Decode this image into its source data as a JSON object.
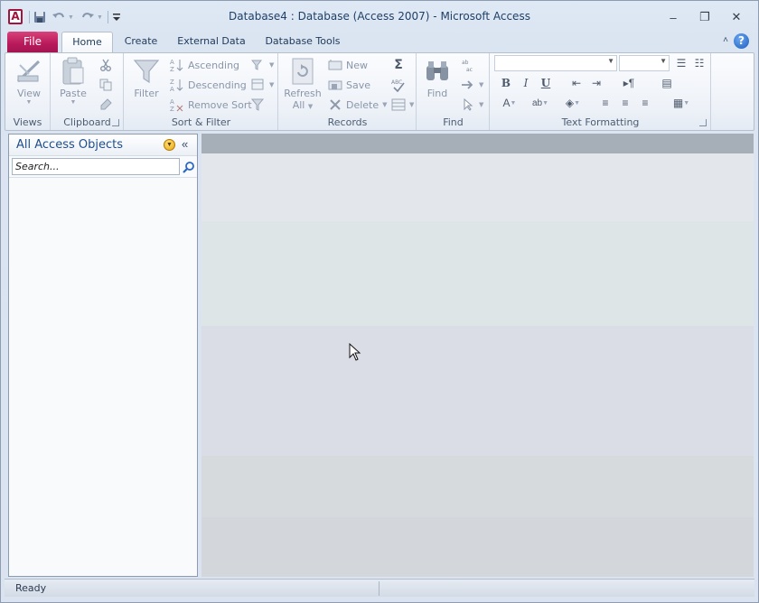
{
  "window": {
    "title": "Database4 : Database (Access 2007)  -  Microsoft Access",
    "app_icon_letter": "A",
    "controls": {
      "minimize": "–",
      "restore": "❐",
      "close": "✕"
    }
  },
  "quick_access": {
    "save": "save-icon",
    "undo": "undo-icon",
    "redo": "redo-icon",
    "customize": "customize-icon"
  },
  "tabs": {
    "file": "File",
    "home": "Home",
    "create": "Create",
    "external_data": "External Data",
    "database_tools": "Database Tools"
  },
  "ribbon": {
    "views": {
      "view_label": "View",
      "group_label": "Views"
    },
    "clipboard": {
      "paste_label": "Paste",
      "group_label": "Clipboard"
    },
    "sort_filter": {
      "filter_label": "Filter",
      "ascending": "Ascending",
      "descending": "Descending",
      "remove_sort": "Remove Sort",
      "group_label": "Sort & Filter"
    },
    "records": {
      "refresh_label": "Refresh",
      "refresh_sub": "All",
      "new": "New",
      "save": "Save",
      "delete": "Delete",
      "group_label": "Records"
    },
    "find": {
      "find_label": "Find",
      "group_label": "Find"
    },
    "text_formatting": {
      "bold": "B",
      "italic": "I",
      "underline": "U",
      "group_label": "Text Formatting"
    }
  },
  "nav_pane": {
    "title": "All Access Objects",
    "search_placeholder": "Search..."
  },
  "status": {
    "text": "Ready"
  },
  "colors": {
    "file_tab": "#b8195a",
    "accent_blue": "#1f4e8c",
    "workspace_header": "#a6aeb8"
  }
}
